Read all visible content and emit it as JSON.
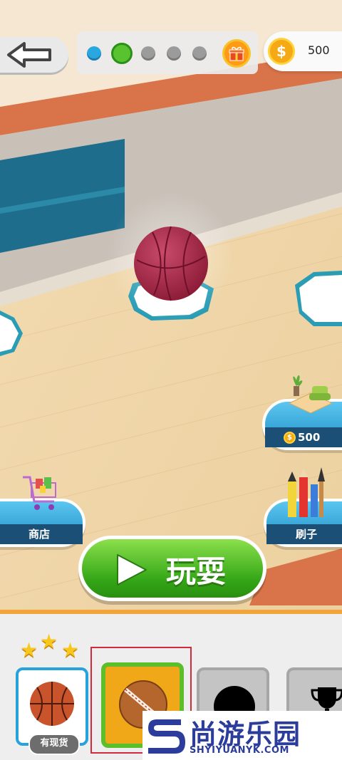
{
  "coins": {
    "amount": "500"
  },
  "level_progress": {
    "total": 5,
    "current_index": 1
  },
  "room_button": {
    "price": "500",
    "currency_symbol": "$"
  },
  "shop_button": {
    "label": "商店"
  },
  "brush_button": {
    "label": "刷子"
  },
  "play_button": {
    "label": "玩耍"
  },
  "ball_tray": {
    "stars": 3,
    "cards": [
      {
        "id": "basketball",
        "badge": "有现货",
        "locked": false
      },
      {
        "id": "baseball",
        "selected": true,
        "locked": false
      },
      {
        "id": "locked-ball",
        "locked": true
      },
      {
        "id": "trophy",
        "locked": true
      }
    ]
  },
  "watermark": {
    "title": "尚游乐园",
    "url": "SHYIYUANYK.COM"
  },
  "colors": {
    "accent_green": "#34a617",
    "coin_gold": "#f5a915",
    "sky_blue": "#27a2db"
  }
}
